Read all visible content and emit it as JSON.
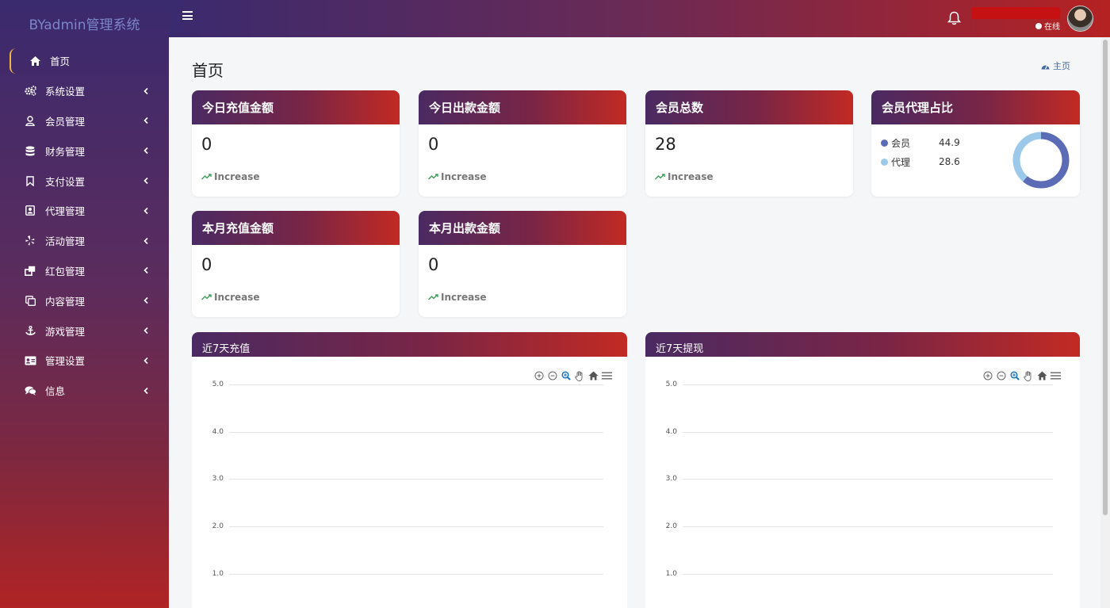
{
  "app": {
    "brand": "BYadmin管理系统"
  },
  "sidebar": {
    "items": [
      {
        "label": "首页",
        "icon": "home-icon"
      },
      {
        "label": "系统设置",
        "icon": "gears-icon"
      },
      {
        "label": "会员管理",
        "icon": "user-icon"
      },
      {
        "label": "财务管理",
        "icon": "database-icon"
      },
      {
        "label": "支付设置",
        "icon": "bookmark-icon"
      },
      {
        "label": "代理管理",
        "icon": "contact-card-icon"
      },
      {
        "label": "活动管理",
        "icon": "yelp-icon"
      },
      {
        "label": "红包管理",
        "icon": "clone-icon"
      },
      {
        "label": "内容管理",
        "icon": "copy-icon"
      },
      {
        "label": "游戏管理",
        "icon": "anchor-icon"
      },
      {
        "label": "管理设置",
        "icon": "id-card-icon"
      },
      {
        "label": "信息",
        "icon": "comments-icon"
      }
    ]
  },
  "header": {
    "status": "在线"
  },
  "page": {
    "title": "首页",
    "breadcrumb": "主页"
  },
  "stats": [
    {
      "title": "今日充值金额",
      "value": "0",
      "trend": "Increase"
    },
    {
      "title": "今日出款金额",
      "value": "0",
      "trend": "Increase"
    },
    {
      "title": "会员总数",
      "value": "28",
      "trend": "Increase"
    },
    {
      "title": "本月充值金额",
      "value": "0",
      "trend": "Increase"
    },
    {
      "title": "本月出款金额",
      "value": "0",
      "trend": "Increase"
    }
  ],
  "ratio": {
    "title": "会员代理占比",
    "items": [
      {
        "name": "会员",
        "value": "44.9",
        "color": "#5b6bb5"
      },
      {
        "name": "代理",
        "value": "28.6",
        "color": "#9cc8ea"
      }
    ]
  },
  "colors": {
    "accent": "#f0b63d",
    "trend": "#2e9a4e",
    "link": "#4a6aa5"
  },
  "chart_data": [
    {
      "type": "line",
      "title": "近7天充值",
      "yticks": [
        "5.0",
        "4.0",
        "3.0",
        "2.0",
        "1.0"
      ],
      "ylim": [
        0,
        5
      ],
      "grid": true,
      "series": []
    },
    {
      "type": "line",
      "title": "近7天提现",
      "yticks": [
        "5.0",
        "4.0",
        "3.0",
        "2.0",
        "1.0"
      ],
      "ylim": [
        0,
        5
      ],
      "grid": true,
      "series": []
    }
  ]
}
